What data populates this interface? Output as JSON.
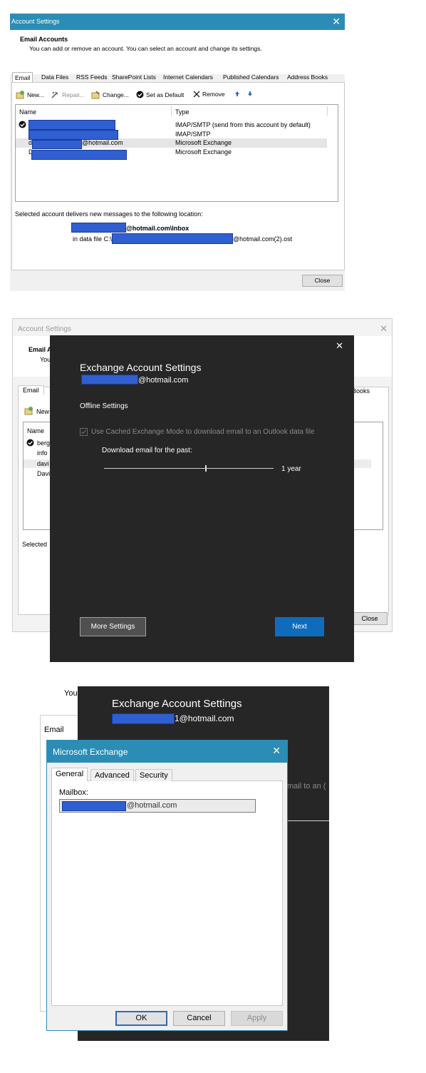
{
  "panel1": {
    "title": "Account Settings",
    "close_glyph": "✕",
    "heading": "Email Accounts",
    "subtitle": "You can add or remove an account. You can select an account and change its settings.",
    "tabs": [
      "Email",
      "Data Files",
      "RSS Feeds",
      "SharePoint Lists",
      "Internet Calendars",
      "Published Calendars",
      "Address Books"
    ],
    "toolbar": {
      "new": "New...",
      "repair": "Repair...",
      "change": "Change...",
      "set_default": "Set as Default",
      "remove": "Remove"
    },
    "columns": {
      "name": "Name",
      "type": "Type"
    },
    "rows": [
      {
        "name_prefix": "",
        "name_suffix": "",
        "type": "IMAP/SMTP (send from this account by default)"
      },
      {
        "name_prefix": "",
        "name_suffix": "",
        "type": "IMAP/SMTP"
      },
      {
        "name_prefix": "d",
        "name_suffix": "@hotmail.com",
        "type": "Microsoft Exchange"
      },
      {
        "name_prefix": "D",
        "name_suffix": "",
        "type": "Microsoft Exchange"
      }
    ],
    "delivery_text": "Selected account delivers new messages to the following location:",
    "inbox_suffix": "@hotmail.com\\Inbox",
    "datafile_prefix": "in data file C:\\",
    "datafile_suffix": "@hotmail.com(2).ost",
    "close_label": "Close"
  },
  "panel2": {
    "bg_title": "Account Settings",
    "bg_close": "✕",
    "bg_heading_partial": "Email A",
    "bg_sub_partial": "You",
    "bg_tab_email": "Email",
    "bg_tab_books": "Books",
    "bg_new": "New",
    "bg_name_col": "Name",
    "bg_rows": [
      "berg",
      "info",
      "davi",
      "Davi"
    ],
    "bg_selected": "Selected",
    "bg_close_label": "Close",
    "dlg_close": "✕",
    "dlg_title": "Exchange Account Settings",
    "dlg_email_suffix": "@hotmail.com",
    "offline_heading": "Offline Settings",
    "cached_mode_label": "Use Cached Exchange Mode to download email to an Outlook data file",
    "download_label": "Download email for the past:",
    "slider_value": "1 year",
    "slider_fraction": 0.6,
    "more_settings": "More Settings",
    "next": "Next",
    "accent": "#0f6cbd"
  },
  "panel3": {
    "bg_you": "You",
    "bg_email_tab": "Email",
    "bg_dlg_title": "Exchange Account Settings",
    "bg_dlg_email_suffix": "1@hotmail.com",
    "bg_partial_text": "mail to an (",
    "dialog_title": "Microsoft Exchange",
    "dialog_close": "✕",
    "tabs": [
      "General",
      "Advanced",
      "Security"
    ],
    "mailbox_label": "Mailbox:",
    "mailbox_suffix": "@hotmail.com",
    "ok": "OK",
    "cancel": "Cancel",
    "apply": "Apply",
    "title_color": "#2b8db5"
  }
}
